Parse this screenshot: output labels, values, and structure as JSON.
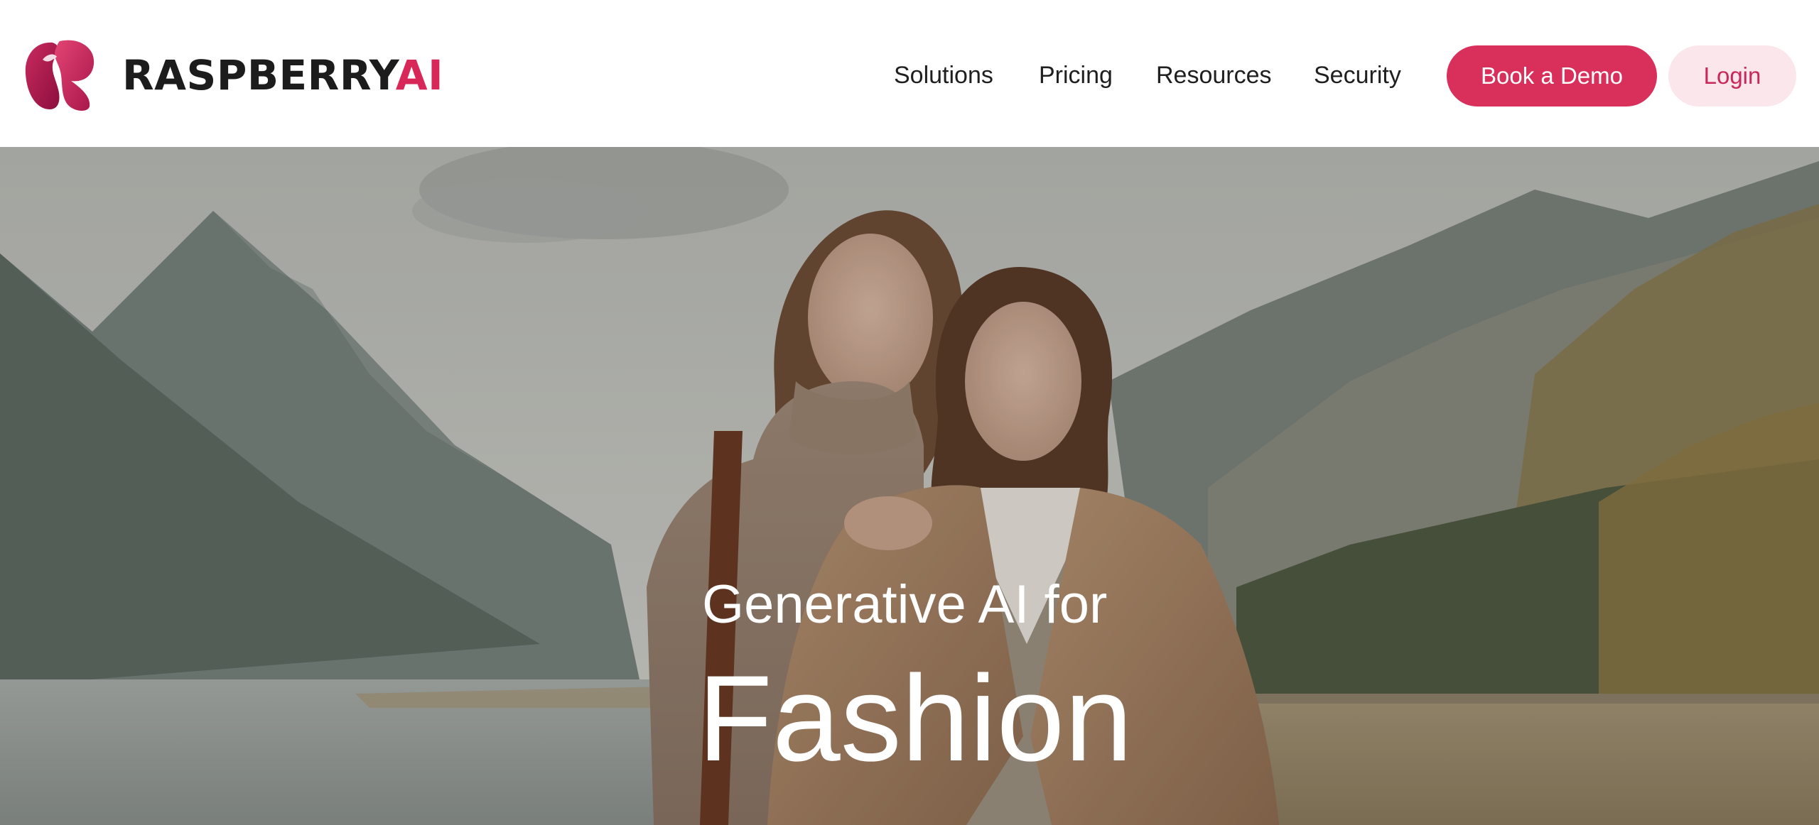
{
  "brand": {
    "name_main": "RASPBERRY",
    "name_accent": "AI",
    "logo_icon": "raspberry-r-logo-icon",
    "accent_color": "#d8305b",
    "accent_light": "#fbe6ec"
  },
  "nav": {
    "items": [
      {
        "label": "Solutions"
      },
      {
        "label": "Pricing"
      },
      {
        "label": "Resources"
      },
      {
        "label": "Security"
      }
    ],
    "book_demo_label": "Book a Demo",
    "login_label": "Login"
  },
  "hero": {
    "subtitle": "Generative AI for",
    "title": "Fashion"
  }
}
